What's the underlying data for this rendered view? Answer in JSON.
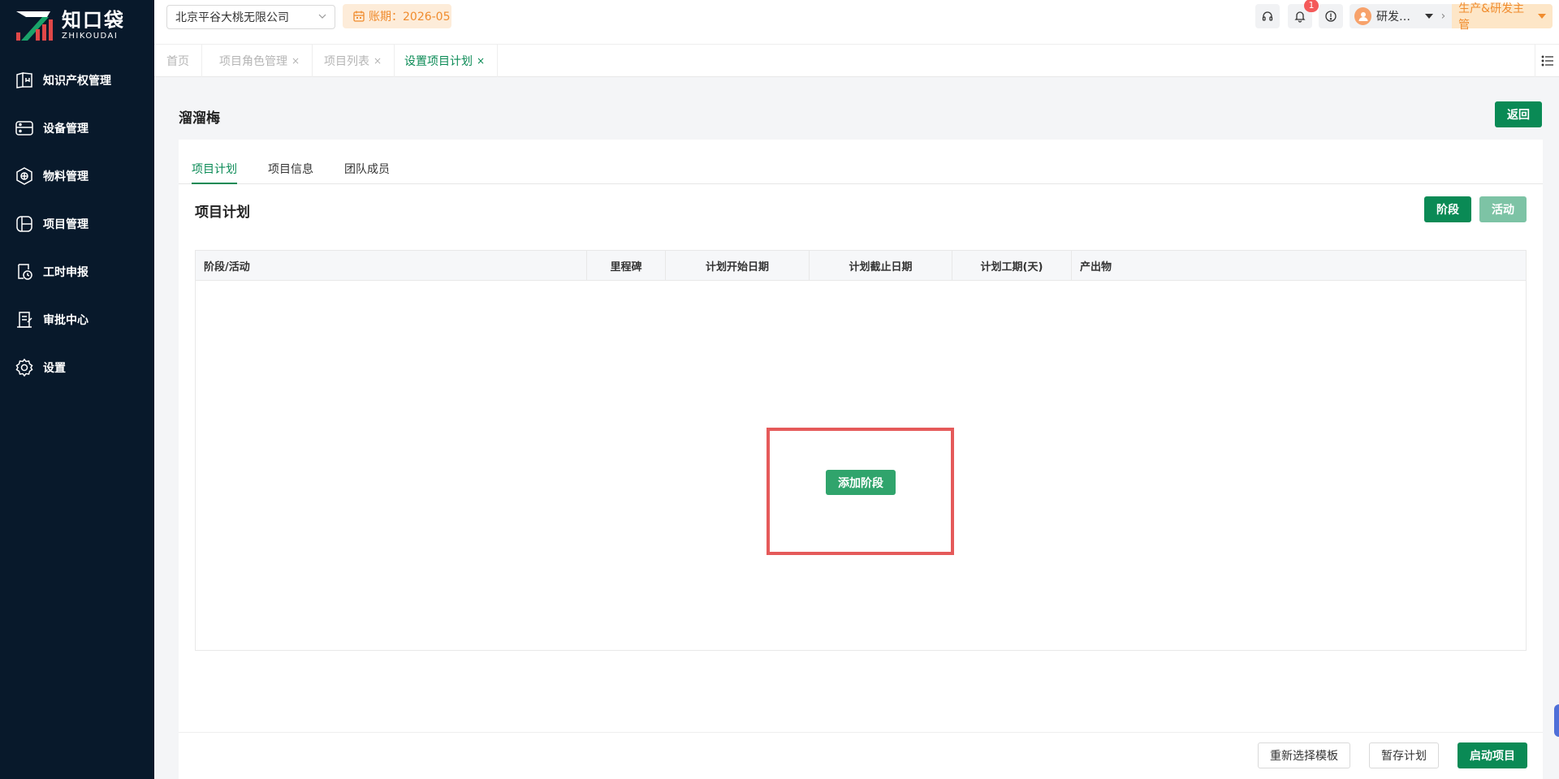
{
  "brand": {
    "name_cn": "知口袋",
    "name_en": "ZHIKOUDAI",
    "colors": {
      "primary": "#0a8a55",
      "sidebar": "#08192b",
      "accent_orange": "#f08c2e",
      "alert_red": "#e55a5a"
    }
  },
  "sidebar": {
    "items": [
      {
        "label": "知识产权管理",
        "icon": "book-icon"
      },
      {
        "label": "设备管理",
        "icon": "device-icon"
      },
      {
        "label": "物料管理",
        "icon": "box-icon"
      },
      {
        "label": "项目管理",
        "icon": "project-icon"
      },
      {
        "label": "工时申报",
        "icon": "timesheet-icon"
      },
      {
        "label": "审批中心",
        "icon": "approval-icon"
      },
      {
        "label": "设置",
        "icon": "gear-icon"
      }
    ]
  },
  "header": {
    "company": "北京平谷大桃无限公司",
    "period": "账期：2026-05",
    "notification_count": "1",
    "user_name": "研发…",
    "role": "生产&研发主管"
  },
  "tabs": [
    {
      "label": "首页",
      "closable": false
    },
    {
      "label": "项目角色管理",
      "closable": true
    },
    {
      "label": "项目列表",
      "closable": true
    },
    {
      "label": "设置项目计划",
      "closable": true,
      "active": true
    }
  ],
  "tab_close_glyph": "×",
  "page": {
    "title": "溜溜梅",
    "back_label": "返回"
  },
  "subtabs": [
    {
      "label": "项目计划",
      "active": true
    },
    {
      "label": "项目信息"
    },
    {
      "label": "团队成员"
    }
  ],
  "plan": {
    "section_title": "项目计划",
    "stage_button": "阶段",
    "activity_button": "活动",
    "columns": [
      "阶段/活动",
      "里程碑",
      "计划开始日期",
      "计划截止日期",
      "计划工期(天)",
      "产出物"
    ],
    "rows": [],
    "add_stage_label": "添加阶段"
  },
  "footer": {
    "reselect_template": "重新选择模板",
    "save_draft": "暂存计划",
    "start_project": "启动项目"
  }
}
